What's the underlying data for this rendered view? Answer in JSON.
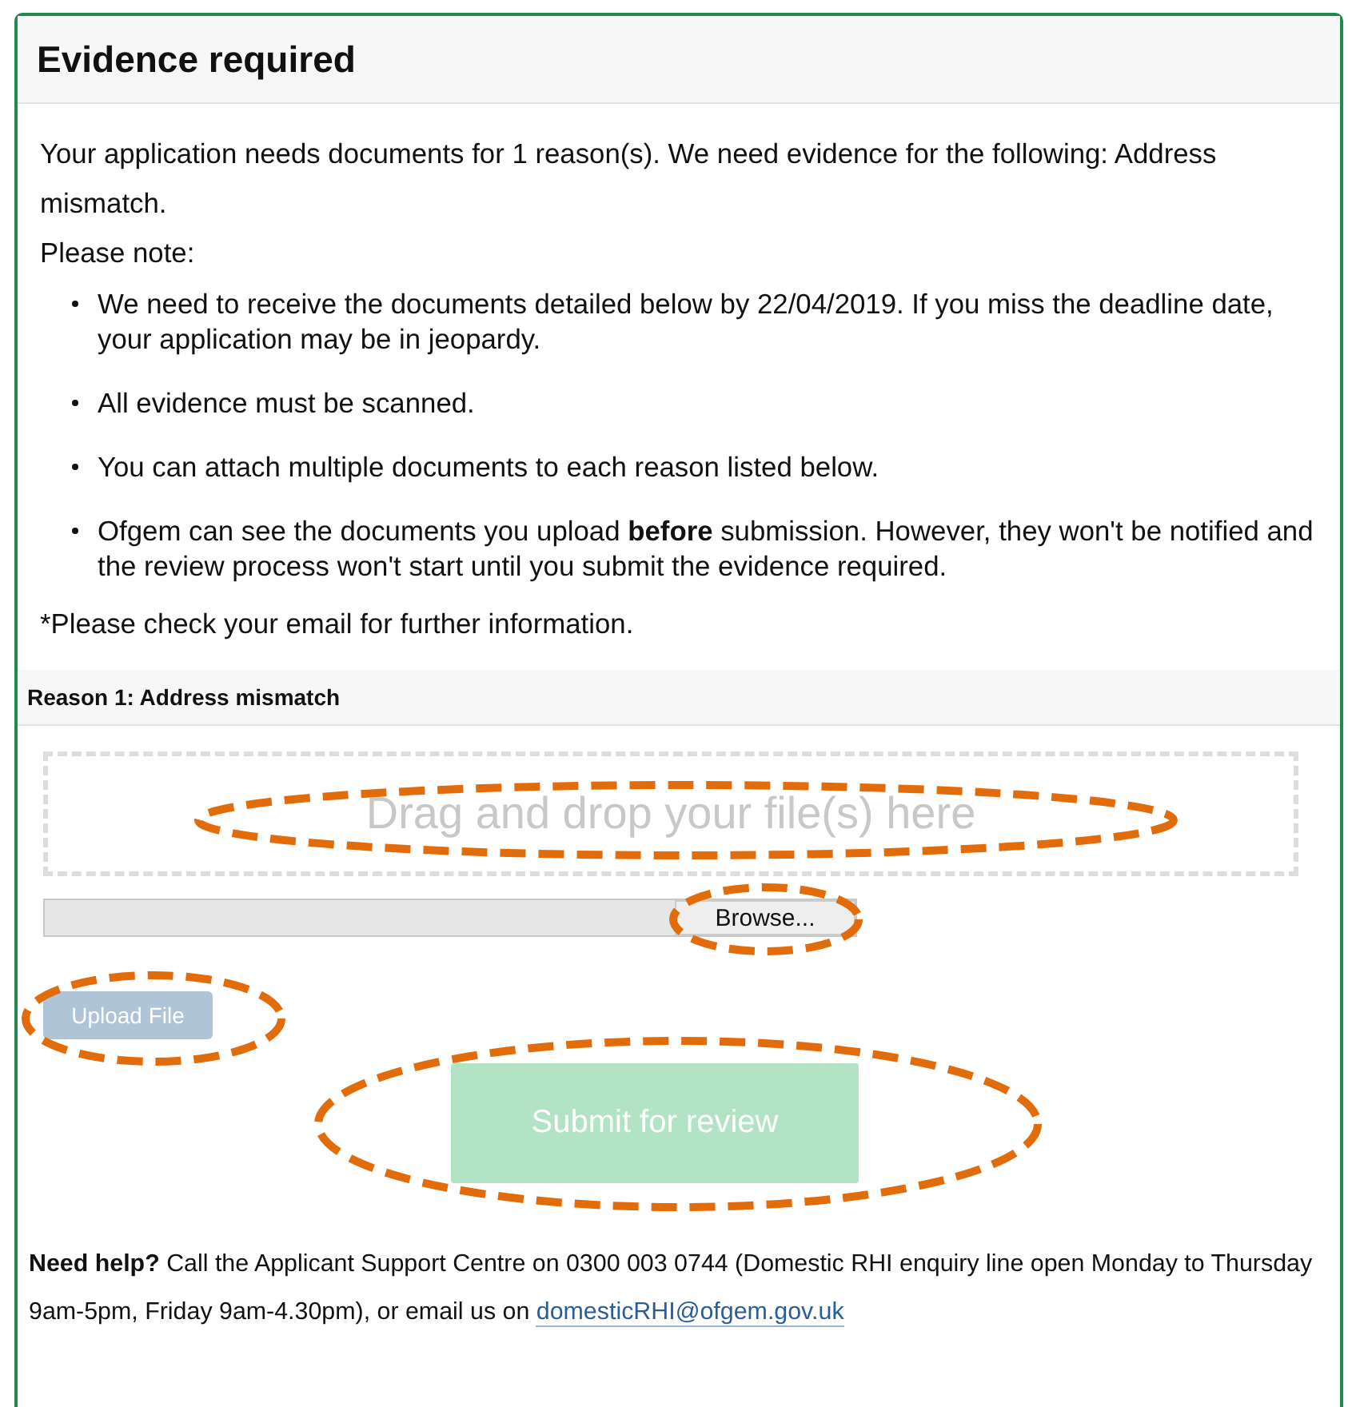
{
  "panel": {
    "title": "Evidence required"
  },
  "intro": "Your application needs documents for 1 reason(s). We need evidence for the following: Address mismatch.",
  "note_heading": "Please note:",
  "notes": [
    "We need to receive the documents detailed below by 22/04/2019. If you miss the deadline date, your application may be in jeopardy.",
    "All evidence must be scanned.",
    "You can attach multiple documents to each reason listed below.",
    "Ofgem can see the documents you upload **before** submission. However, they won't be notified and the review process won't start until you submit the evidence required."
  ],
  "email_note": "*Please check your email for further information.",
  "reason": {
    "heading": "Reason 1: Address mismatch",
    "dropzone": {
      "text": "Drag and drop your file(s) here",
      "highlighted": true
    },
    "browse_button": {
      "label": "Browse...",
      "highlighted": true
    },
    "upload_button": {
      "label": "Upload File",
      "disabled": true,
      "highlighted": true
    }
  },
  "submit_button": {
    "label": "Submit for review",
    "disabled": true,
    "highlighted": true
  },
  "help": {
    "text": "**Need help?** Call the Applicant Support Centre on 0300 003 0744 (Domestic RHI enquiry line open Monday to Thursday 9am-5pm, Friday 9am-4.30pm), or email us on",
    "email": "domesticRHI@ofgem.gov.uk"
  }
}
